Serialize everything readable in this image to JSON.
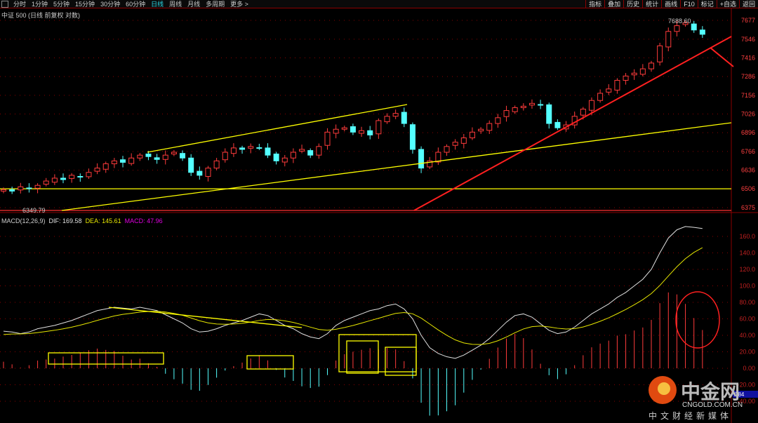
{
  "toolbar": {
    "tabs": [
      "分时",
      "1分钟",
      "5分钟",
      "15分钟",
      "30分钟",
      "60分钟",
      "日线",
      "周线",
      "月线",
      "多周期",
      "更多 >"
    ],
    "active": "日线",
    "right_buttons": [
      "指标",
      "叠加",
      "历史",
      "统计",
      "画线",
      "F10",
      "标记",
      "+自选",
      "返回"
    ]
  },
  "chart_title": "中证 500 (日线 前复权 对数)",
  "price_axis": [
    "7677",
    "7546",
    "7416",
    "7286",
    "7156",
    "7026",
    "6896",
    "6766",
    "6636",
    "6506",
    "6375"
  ],
  "high_label": "7688.60",
  "low_label": "6349.79",
  "macd": {
    "name": "MACD(12,26,9)",
    "dif": "DIF: 169.58",
    "dea": "DEA: 145.61",
    "macd": "MACD: 47.96",
    "axis": [
      "160.0",
      "140.0",
      "120.0",
      "100.0",
      "80.00",
      "60.00",
      "40.00",
      "20.00",
      "0.00",
      "-20.00",
      "-40.00"
    ],
    "cursor_value": "384"
  },
  "colors": {
    "up": "#ff3b3b",
    "down": "#54ffff",
    "dif": "#e0e0e0",
    "dea": "#e6e600",
    "macd": "#e000e0",
    "grid": "#8a0000"
  },
  "watermark": {
    "brand": "中金网",
    "url": "CNGOLD.COM.CN",
    "slogan": "中文财经新媒体"
  },
  "chart_data": {
    "type": "candlestick",
    "closes": [
      6500,
      6490,
      6520,
      6510,
      6530,
      6560,
      6580,
      6570,
      6600,
      6590,
      6620,
      6650,
      6680,
      6700,
      6690,
      6720,
      6740,
      6730,
      6710,
      6740,
      6760,
      6720,
      6620,
      6600,
      6650,
      6700,
      6760,
      6790,
      6780,
      6800,
      6790,
      6740,
      6700,
      6720,
      6760,
      6780,
      6740,
      6800,
      6900,
      6920,
      6930,
      6900,
      6910,
      6880,
      6980,
      7010,
      7030,
      6960,
      6780,
      6650,
      6700,
      6760,
      6800,
      6830,
      6860,
      6900,
      6920,
      6960,
      7000,
      7050,
      7070,
      7080,
      7100,
      7090,
      6960,
      6930,
      6950,
      7010,
      7060,
      7120,
      7170,
      7200,
      7260,
      7290,
      7310,
      7340,
      7380,
      7500,
      7600,
      7640,
      7660,
      7610,
      7580
    ],
    "dif": [
      45,
      44,
      42,
      44,
      48,
      50,
      52,
      55,
      58,
      62,
      66,
      70,
      72,
      74,
      73,
      72,
      74,
      72,
      70,
      65,
      60,
      55,
      48,
      44,
      45,
      48,
      52,
      55,
      58,
      62,
      66,
      64,
      58,
      52,
      48,
      42,
      38,
      36,
      42,
      52,
      58,
      62,
      66,
      70,
      72,
      76,
      78,
      72,
      60,
      40,
      25,
      18,
      14,
      12,
      16,
      22,
      28,
      36,
      46,
      56,
      64,
      66,
      62,
      54,
      46,
      42,
      44,
      50,
      58,
      66,
      72,
      78,
      86,
      92,
      100,
      108,
      120,
      140,
      158,
      168,
      172,
      171,
      169.58
    ],
    "yrange_price": [
      6375,
      7677
    ],
    "yrange_macd": [
      -40,
      160
    ]
  }
}
